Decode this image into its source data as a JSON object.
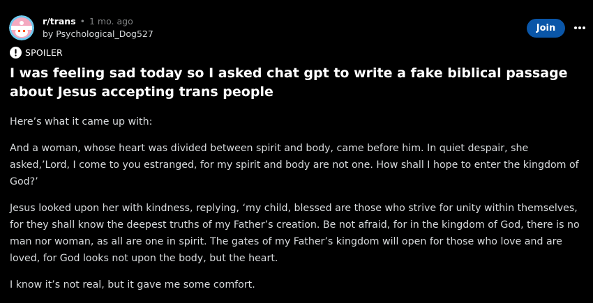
{
  "header": {
    "subreddit": "r/trans",
    "separator": "•",
    "age": "1 mo. ago",
    "author_line": "by Psychological_Dog527",
    "join_label": "Join"
  },
  "post": {
    "spoiler_label": "SPOILER",
    "title": "I was feeling sad today so I asked chat gpt to write a fake biblical passage about Jesus accepting trans people",
    "paragraphs": [
      "Here’s what it came up with:",
      "And a woman, whose heart was divided between spirit and body, came before him. In quiet despair, she asked,’Lord, I come to you estranged, for my spirit and body are not one. How shall I hope to enter the kingdom of God?’",
      "Jesus looked upon her with kindness, replying, ‘my child, blessed are those who strive for unity within themselves, for they shall know the deepest truths of my Father’s creation. Be not afraid, for in the kingdom of God, there is no man nor woman, as all are one in spirit. The gates of my Father’s kingdom will open for those who love and are loved, for God looks not upon the body, but the heart.",
      "I know it’s not real, but it gave me some comfort."
    ]
  },
  "colors": {
    "background": "#000000",
    "join_button": "#0a56a8",
    "text_primary": "#ffffff",
    "text_body": "#d7dadc",
    "text_muted": "#818384",
    "avatar_ring": "#6fc9ee"
  },
  "icons": {
    "avatar": "subreddit-avatar-icon",
    "more": "more-options-icon",
    "spoiler": "spoiler-warning-icon"
  }
}
